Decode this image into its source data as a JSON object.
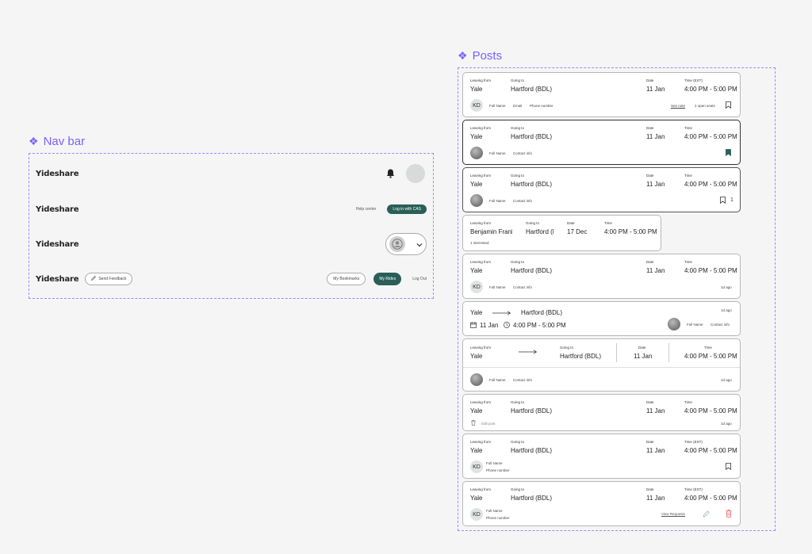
{
  "navbar": {
    "title": "Nav bar",
    "logo": "Yideshare",
    "help_center": "Help center",
    "login_cas": "Log in with CAS",
    "send_feedback": "Send Feedback",
    "my_bookmarks": "My Bookmarks",
    "my_rides": "My Rides",
    "log_out": "Log Out"
  },
  "posts": {
    "title": "Posts",
    "lbl_leaving": "Leaving from",
    "lbl_going": "Going to",
    "lbl_date": "Date",
    "lbl_time": "Time",
    "lbl_time_est": "Time (EST)",
    "from": "Yale",
    "to": "Hartford (BDL)",
    "date": "11 Jan",
    "time": "4:00 PM - 5:00 PM",
    "initials": "KD",
    "full_name": "Full Name",
    "email": "Email",
    "phone_number": "Phone number",
    "contact_info": "Contact info",
    "see_note": "See note",
    "open_seats": "2 open seats",
    "bookmark_count": "1",
    "ago": "1d ago",
    "edit_post": "Edit post",
    "view_requests": "View Requests",
    "card4": {
      "from": "Benjamin Franklin",
      "to": "Hartford (BDL)",
      "date": "17 Dec",
      "time": "4:00 PM - 5:00 PM",
      "interested": "1 interested"
    }
  },
  "colors": {
    "accent": "#7b61ff",
    "brand": "#2a5f57",
    "danger": "#e05555"
  }
}
